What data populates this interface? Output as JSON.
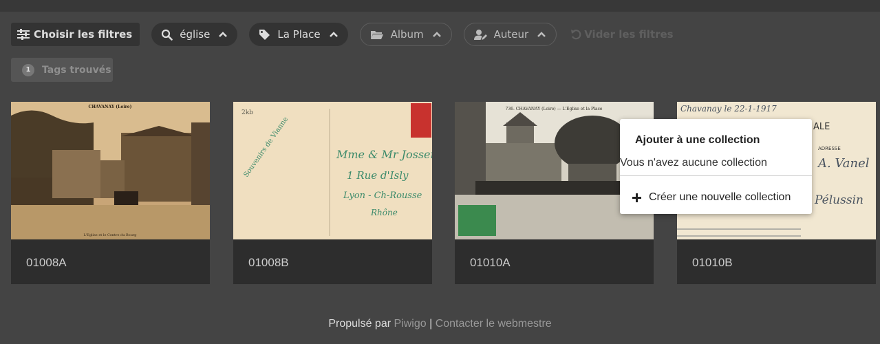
{
  "filters": {
    "choose_label": "Choisir les filtres",
    "search": {
      "label": "église",
      "icon": "search-icon"
    },
    "tag": {
      "label": "La Place",
      "icon": "tag-icon"
    },
    "album": {
      "label": "Album",
      "icon": "folder-icon"
    },
    "author": {
      "label": "Auteur",
      "icon": "user-edit-icon"
    },
    "clear_label": "Vider les filtres"
  },
  "tags_found": {
    "count": "1",
    "label": "Tags trouvés"
  },
  "photos": [
    {
      "caption": "01008A",
      "header": "CHAVANAY (Loire)",
      "footer": "L'Eglise et le Centre du Bourg"
    },
    {
      "caption": "01008B",
      "text_lines": [
        "Mme & Mr Josserand",
        "1 Rue d'Isly",
        "Lyon - Ch-Rousse",
        "Rhône"
      ]
    },
    {
      "caption": "01010A",
      "header": "736. CHAVANAY (Loire) — L'Eglise et la Place"
    },
    {
      "caption": "01010B",
      "text_lines": [
        "Chavanay le 22-1-1917",
        "ALE",
        "ADRESSE",
        "A. Vanel",
        "Pélussin"
      ]
    }
  ],
  "collection_popup": {
    "title": "Ajouter à une collection",
    "empty_message": "Vous n'avez aucune collection",
    "create_label": "Créer une nouvelle collection"
  },
  "footer": {
    "powered_prefix": "Propulsé par",
    "powered_link": "Piwigo",
    "separator": "|",
    "contact_link": "Contacter le webmestre"
  },
  "colors": {
    "background": "#444444",
    "card": "#2d2d2d",
    "pill": "#333333"
  }
}
